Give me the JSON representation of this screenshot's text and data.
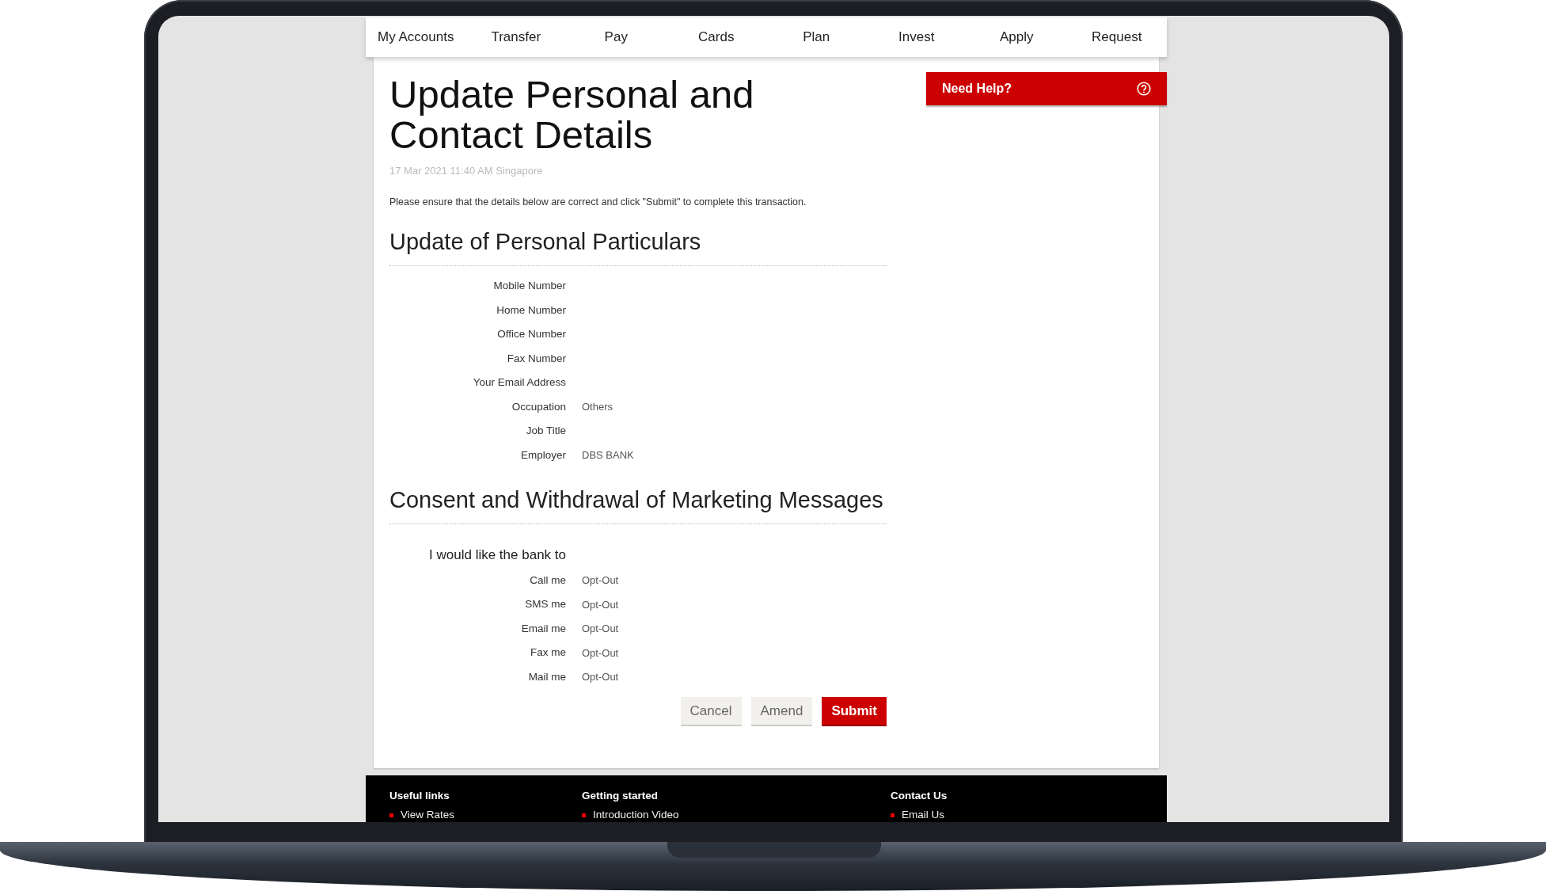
{
  "nav": {
    "items": [
      {
        "label": "My Accounts"
      },
      {
        "label": "Transfer"
      },
      {
        "label": "Pay"
      },
      {
        "label": "Cards"
      },
      {
        "label": "Plan"
      },
      {
        "label": "Invest"
      },
      {
        "label": "Apply"
      },
      {
        "label": "Request"
      }
    ]
  },
  "title": "Update Personal and Contact Details",
  "timestamp": "17 Mar 2021 11:40 AM Singapore",
  "instruction": "Please ensure that the details below are correct and click \"Submit\" to complete this transaction.",
  "help": {
    "label": "Need Help?"
  },
  "sections": [
    {
      "heading": "Update of Personal Particulars",
      "fields": [
        {
          "label": "Mobile Number"
        },
        {
          "label": "Home Number"
        },
        {
          "label": "Office Number"
        },
        {
          "label": "Fax Number"
        },
        {
          "label": "Your Email Address"
        },
        {
          "label": "Occupation",
          "value": "Others"
        },
        {
          "label": "Job Title"
        },
        {
          "label": "Employer",
          "value": "DBS BANK"
        }
      ]
    },
    {
      "heading": "Consent and Withdrawal of Marketing Messages",
      "intro": "I would like the bank to",
      "fields": [
        {
          "label": "Call me",
          "value": "Opt-Out"
        },
        {
          "label": "SMS me",
          "value": "Opt-Out"
        },
        {
          "label": "Email me",
          "value": "Opt-Out"
        },
        {
          "label": "Fax me",
          "value": "Opt-Out"
        },
        {
          "label": "Mail me",
          "value": "Opt-Out"
        }
      ]
    }
  ],
  "buttons": [
    {
      "label": "Cancel",
      "kind": "secondary"
    },
    {
      "label": "Amend",
      "kind": "secondary"
    },
    {
      "label": "Submit",
      "kind": "primary"
    }
  ],
  "footer": {
    "columns": [
      {
        "heading": "Useful links",
        "links": [
          "View Rates"
        ]
      },
      {
        "heading": "Getting started",
        "links": [
          "Introduction Video"
        ]
      },
      {
        "heading": "Contact Us",
        "links": [
          "Email Us"
        ]
      }
    ]
  }
}
